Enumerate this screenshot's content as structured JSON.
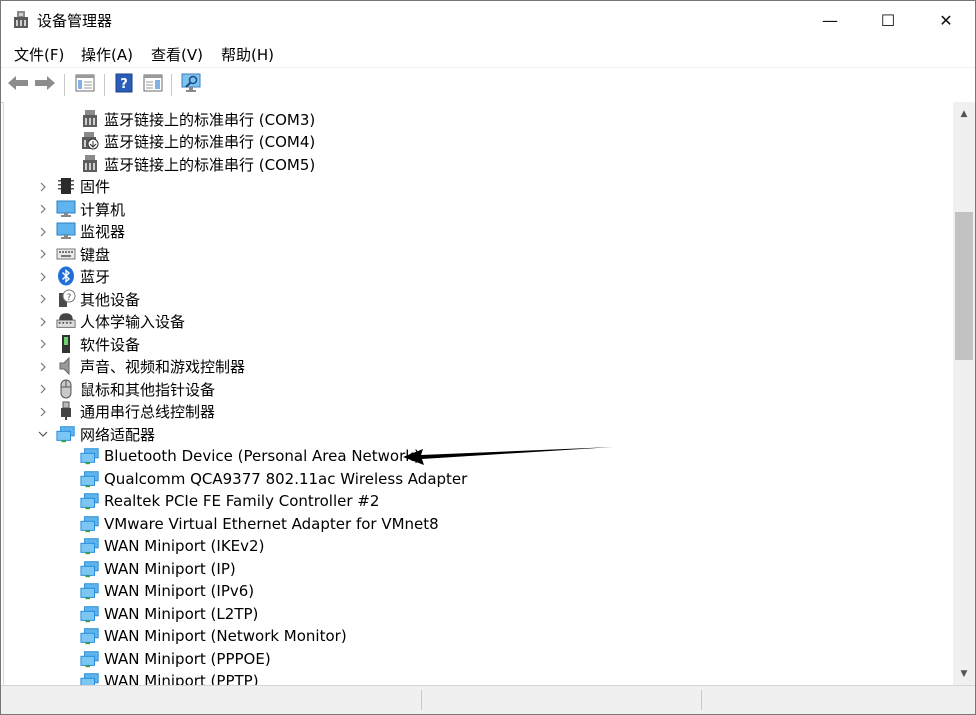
{
  "window": {
    "title": "设备管理器",
    "controls": {
      "minimize": "—",
      "maximize": "☐",
      "close": "✕"
    }
  },
  "menu": [
    {
      "label": "文件(F)"
    },
    {
      "label": "操作(A)"
    },
    {
      "label": "查看(V)"
    },
    {
      "label": "帮助(H)"
    }
  ],
  "toolbar": {
    "buttons": [
      {
        "icon": "back-arrow-icon"
      },
      {
        "icon": "forward-arrow-icon"
      },
      {
        "icon": "properties-grid-icon"
      },
      {
        "icon": "help-icon"
      },
      {
        "icon": "update-driver-icon"
      },
      {
        "icon": "scan-hardware-monitor-icon"
      }
    ]
  },
  "tree": {
    "ports_children": [
      {
        "label": "蓝牙链接上的标准串行 (COM3)",
        "icon": "serial-port-icon"
      },
      {
        "label": "蓝牙链接上的标准串行 (COM4)",
        "icon": "serial-port-disabled-icon"
      },
      {
        "label": "蓝牙链接上的标准串行 (COM5)",
        "icon": "serial-port-icon"
      }
    ],
    "categories": [
      {
        "label": "固件",
        "icon": "firmware-chip-icon",
        "expanded": false
      },
      {
        "label": "计算机",
        "icon": "computer-icon",
        "expanded": false
      },
      {
        "label": "监视器",
        "icon": "monitor-icon",
        "expanded": false
      },
      {
        "label": "键盘",
        "icon": "keyboard-icon",
        "expanded": false
      },
      {
        "label": "蓝牙",
        "icon": "bluetooth-icon",
        "expanded": false
      },
      {
        "label": "其他设备",
        "icon": "unknown-device-icon",
        "expanded": false
      },
      {
        "label": "人体学输入设备",
        "icon": "hid-icon",
        "expanded": false
      },
      {
        "label": "软件设备",
        "icon": "software-device-icon",
        "expanded": false
      },
      {
        "label": "声音、视频和游戏控制器",
        "icon": "speaker-icon",
        "expanded": false
      },
      {
        "label": "鼠标和其他指针设备",
        "icon": "mouse-icon",
        "expanded": false
      },
      {
        "label": "通用串行总线控制器",
        "icon": "usb-icon",
        "expanded": false
      },
      {
        "label": "网络适配器",
        "icon": "network-adapter-icon",
        "expanded": true
      }
    ],
    "network_children": [
      {
        "label": "Bluetooth Device (Personal Area Network)"
      },
      {
        "label": "Qualcomm QCA9377 802.11ac Wireless Adapter"
      },
      {
        "label": "Realtek PCIe FE Family Controller #2"
      },
      {
        "label": "VMware Virtual Ethernet Adapter for VMnet8"
      },
      {
        "label": "WAN Miniport (IKEv2)"
      },
      {
        "label": "WAN Miniport (IP)"
      },
      {
        "label": "WAN Miniport (IPv6)"
      },
      {
        "label": "WAN Miniport (L2TP)"
      },
      {
        "label": "WAN Miniport (Network Monitor)"
      },
      {
        "label": "WAN Miniport (PPPOE)"
      },
      {
        "label": "WAN Miniport (PPTP)"
      }
    ]
  },
  "colors": {
    "network_icon": "#1e88d8",
    "annotation_arrow": "#000000"
  }
}
